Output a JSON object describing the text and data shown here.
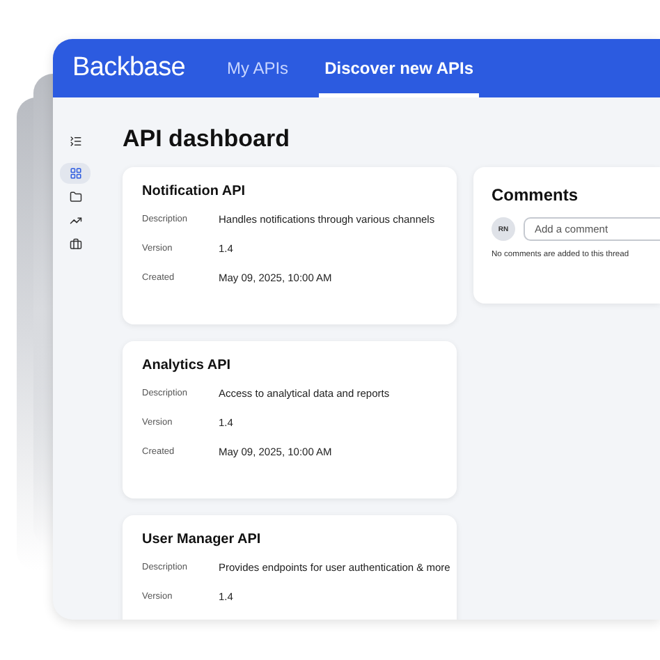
{
  "header": {
    "logo": "Backbase",
    "nav": [
      {
        "label": "My APIs",
        "selected": false
      },
      {
        "label": "Discover new APIs",
        "selected": true
      }
    ]
  },
  "sidebar": {
    "items": [
      {
        "kind": "collapse",
        "selected": false
      },
      {
        "kind": "grid",
        "selected": true
      },
      {
        "kind": "folder",
        "selected": false
      },
      {
        "kind": "chart",
        "selected": false
      },
      {
        "kind": "briefcase",
        "selected": false
      }
    ]
  },
  "title": "API dashboard",
  "cards": [
    {
      "name": "Notification API",
      "fields": [
        {
          "label": "Description",
          "value": "Handles notifications through various channels"
        },
        {
          "label": "Version",
          "value": "1.4"
        },
        {
          "label": "Created",
          "value": "May 09, 2025, 10:00 AM"
        }
      ]
    },
    {
      "name": "Analytics API",
      "fields": [
        {
          "label": "Description",
          "value": "Access to analytical data and reports"
        },
        {
          "label": "Version",
          "value": "1.4"
        },
        {
          "label": "Created",
          "value": "May 09, 2025, 10:00 AM"
        }
      ]
    },
    {
      "name": "User Manager API",
      "fields": [
        {
          "label": "Description",
          "value": "Provides endpoints for user authentication & more"
        },
        {
          "label": "Version",
          "value": "1.4"
        }
      ]
    }
  ],
  "comments": {
    "title": "Comments",
    "avatar": "RN",
    "placeholder": "Add a comment",
    "empty": "No comments are added to this thread"
  }
}
